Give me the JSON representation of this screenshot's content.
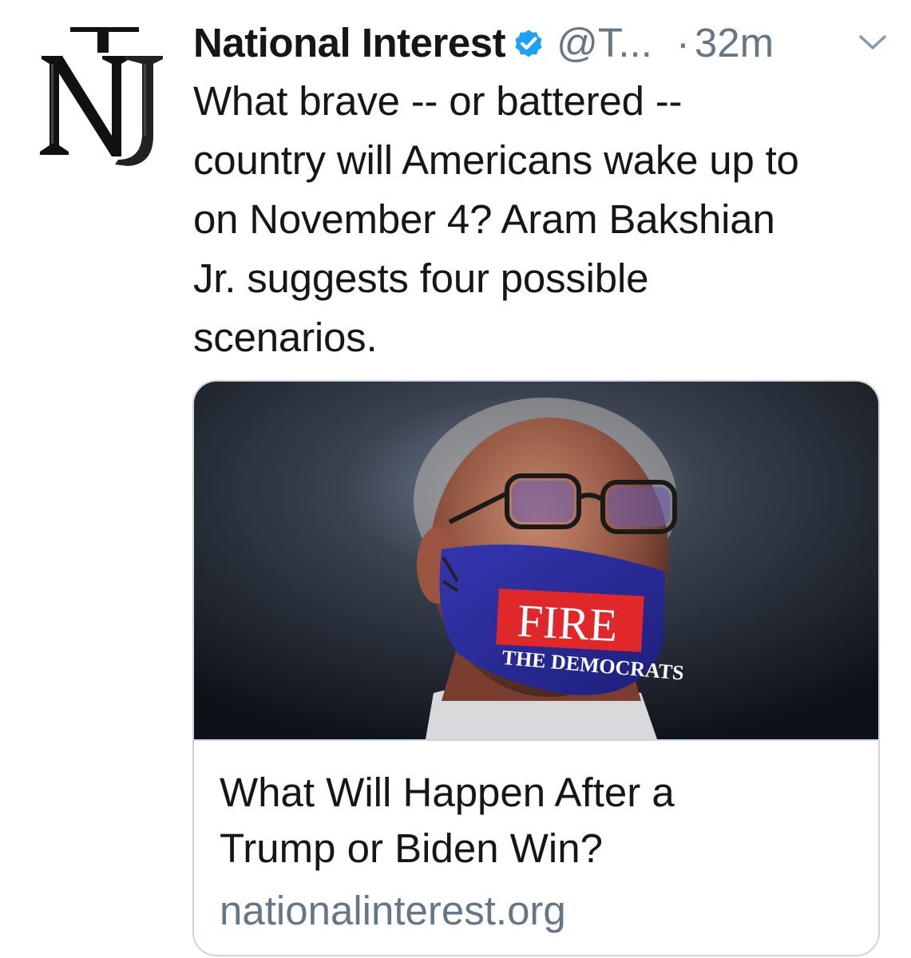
{
  "account": {
    "name": "National Interest",
    "handle": "@T...",
    "separator": "·",
    "time": "32m",
    "avatar_icon": "national-interest-logo-icon",
    "verified_icon": "verified-badge-icon",
    "verified_color": "#1da1f2"
  },
  "tweet": {
    "text": "What brave -- or battered --\ncountry will Americans wake up to\non November 4? Aram Bakshian\nJr. suggests four possible\nscenarios."
  },
  "card": {
    "image_icon": "article-photo",
    "mask_text_main": "FIRE",
    "mask_text_sub": "THE DEMOCRATS",
    "title": "What Will Happen After a\nTrump or Biden Win?",
    "domain": "nationalinterest.org"
  },
  "colors": {
    "text_primary": "#14171a",
    "text_secondary": "#657786",
    "border": "#ccd6dd",
    "mask_blue": "#2b2f9a",
    "mask_red": "#e0272a"
  }
}
